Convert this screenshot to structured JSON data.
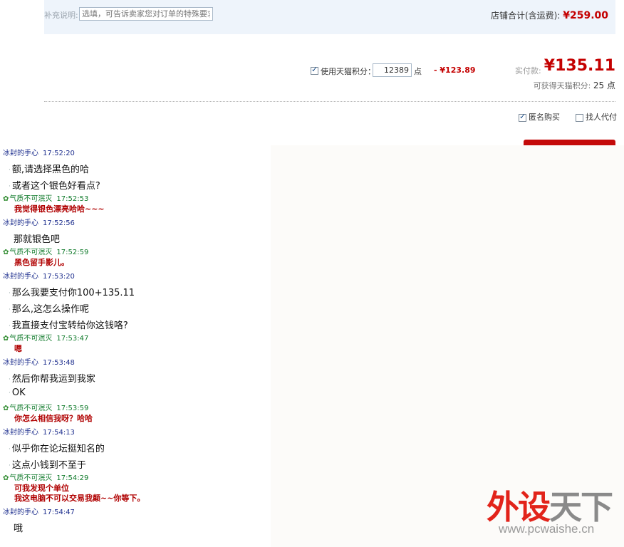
{
  "order": {
    "remark_label": "补充说明:",
    "remark_placeholder": "选填，可告诉卖家您对订单的特殊要求。",
    "shop_total_label": "店铺合计(含运费):",
    "shop_total_amount": "¥259.00",
    "points_checkbox_label": "使用天猫积分：",
    "points_value": "12389",
    "points_unit": "点",
    "points_deduction": "- ¥123.89",
    "pay_label": "实付款:",
    "pay_amount": "¥135.11",
    "earn_label": "可获得天猫积分:",
    "earn_points": "25 点",
    "anonymous_label": "匿名购买",
    "anonymous_checked": true,
    "proxy_label": "找人代付",
    "proxy_checked": false
  },
  "chat": {
    "user_a": "冰封的手心",
    "user_b": "气质不可泯灭",
    "messages": [
      {
        "sender": "冰封的手心",
        "time": "17:52:20",
        "side": "me",
        "lines": [
          "额,请选择黑色的哈",
          "或者这个银色好看点?"
        ]
      },
      {
        "sender": "气质不可泯灭",
        "time": "17:52:53",
        "side": "other",
        "lines": [
          "我觉得银色漂亮哈哈~~~"
        ]
      },
      {
        "sender": "冰封的手心",
        "time": "17:52:56",
        "side": "me",
        "lines": [
          "那就银色吧"
        ]
      },
      {
        "sender": "气质不可泯灭",
        "time": "17:52:59",
        "side": "other",
        "lines": [
          "黑色留手影儿。"
        ]
      },
      {
        "sender": "冰封的手心",
        "time": "17:53:20",
        "side": "me",
        "lines": [
          "那么我要支付你100+135.11",
          "那么,这怎么操作呢",
          "我直接支付宝转给你这钱咯?"
        ]
      },
      {
        "sender": "气质不可泯灭",
        "time": "17:53:47",
        "side": "other",
        "lines": [
          "嗯"
        ]
      },
      {
        "sender": "冰封的手心",
        "time": "17:53:48",
        "side": "me",
        "lines": [
          "然后你帮我运到我家",
          "OK"
        ]
      },
      {
        "sender": "气质不可泯灭",
        "time": "17:53:59",
        "side": "other",
        "lines": [
          "你怎么相信我呀？哈哈"
        ]
      },
      {
        "sender": "冰封的手心",
        "time": "17:54:13",
        "side": "me",
        "lines": [
          "似乎你在论坛挺知名的",
          "这点小钱到不至于"
        ]
      },
      {
        "sender": "气质不可泯灭",
        "time": "17:54:29",
        "side": "other",
        "lines": [
          "可我发现个单位",
          "我这电脑不可以交易我颠~~你等下。"
        ]
      },
      {
        "sender": "冰封的手心",
        "time": "17:54:47",
        "side": "me",
        "lines": [
          "哦"
        ]
      }
    ]
  },
  "watermark": {
    "logo_red": "外设",
    "logo_gray": "天下",
    "url": "www.pcwaishe.cn"
  }
}
